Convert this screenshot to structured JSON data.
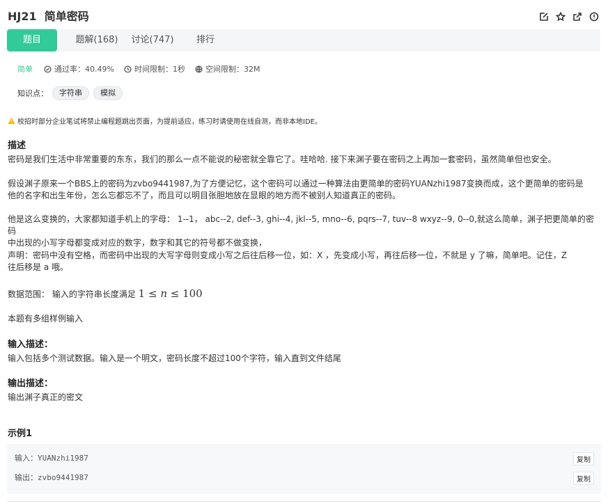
{
  "problem": {
    "id": "HJ21",
    "name": "简单密码"
  },
  "header_icons": [
    "edit-icon",
    "star-icon",
    "share-icon",
    "info-icon"
  ],
  "tabs": [
    {
      "label": "题目",
      "active": true
    },
    {
      "label": "题解(168)",
      "active": false
    },
    {
      "label": "讨论(747)",
      "active": false
    },
    {
      "label": "排行",
      "active": false
    }
  ],
  "meta": {
    "difficulty": "简单",
    "pass_rate": "通过率：40.49%",
    "time_limit": "时间限制：1秒",
    "space_limit": "空间限制：32M"
  },
  "knowledge": {
    "label": "知识点：",
    "tags": [
      "字符串",
      "模拟"
    ]
  },
  "notice": "校招时部分企业笔试将禁止编程题跳出页面，为提前适应，练习时请使用在线自测，而非本地IDE。",
  "description": {
    "title": "描述",
    "p1": "密码是我们生活中非常重要的东东，我们的那么一点不能说的秘密就全靠它了。哇哈哈. 接下来渊子要在密码之上再加一套密码，虽然简单但也安全。",
    "p2a": "假设渊子原来一个BBS上的密码为zvbo9441987,为了方便记忆，这个密码可以通过一种算法由更简单的密码YUANzhi1987变换而成，这个更简单的密码是",
    "p2b": "他的名字和出生年份，怎么忘都忘不了，而且可以明目张胆地放在显眼的地方而不被别人知道真正的密码。",
    "p3a": "他是这么变换的，大家都知道手机上的字母： 1--1， abc--2, def--3, ghi--4, jkl--5, mno--6, pqrs--7, tuv--8 wxyz--9, 0--0,就这么简单，渊子把更简单的密码",
    "p3b": "中出现的小写字母都变成对应的数字，数字和其它的符号都不做变换，",
    "p4a": "声明：密码中没有空格，而密码中出现的大写字母则变成小写之后往后移一位，如：X ，先变成小写，再往后移一位，不就是 y 了嘛，简单吧。记住，Z",
    "p4b": "往后移是 a 哦。",
    "range_prefix": "数据范围： 输入的字符串长度满足",
    "range_low": "1",
    "range_var": "n",
    "range_high": "100",
    "multi": "本题有多组样例输入"
  },
  "input_desc": {
    "title": "输入描述：",
    "text": "输入包括多个测试数据。输入是一个明文，密码长度不超过100个字符，输入直到文件结尾"
  },
  "output_desc": {
    "title": "输出描述：",
    "text": "输出渊子真正的密文"
  },
  "example": {
    "title": "示例1",
    "input_label": "输入：",
    "input_value": "YUANzhi1987",
    "output_label": "输出：",
    "output_value": "zvbo9441987",
    "copy_label": "复制"
  }
}
